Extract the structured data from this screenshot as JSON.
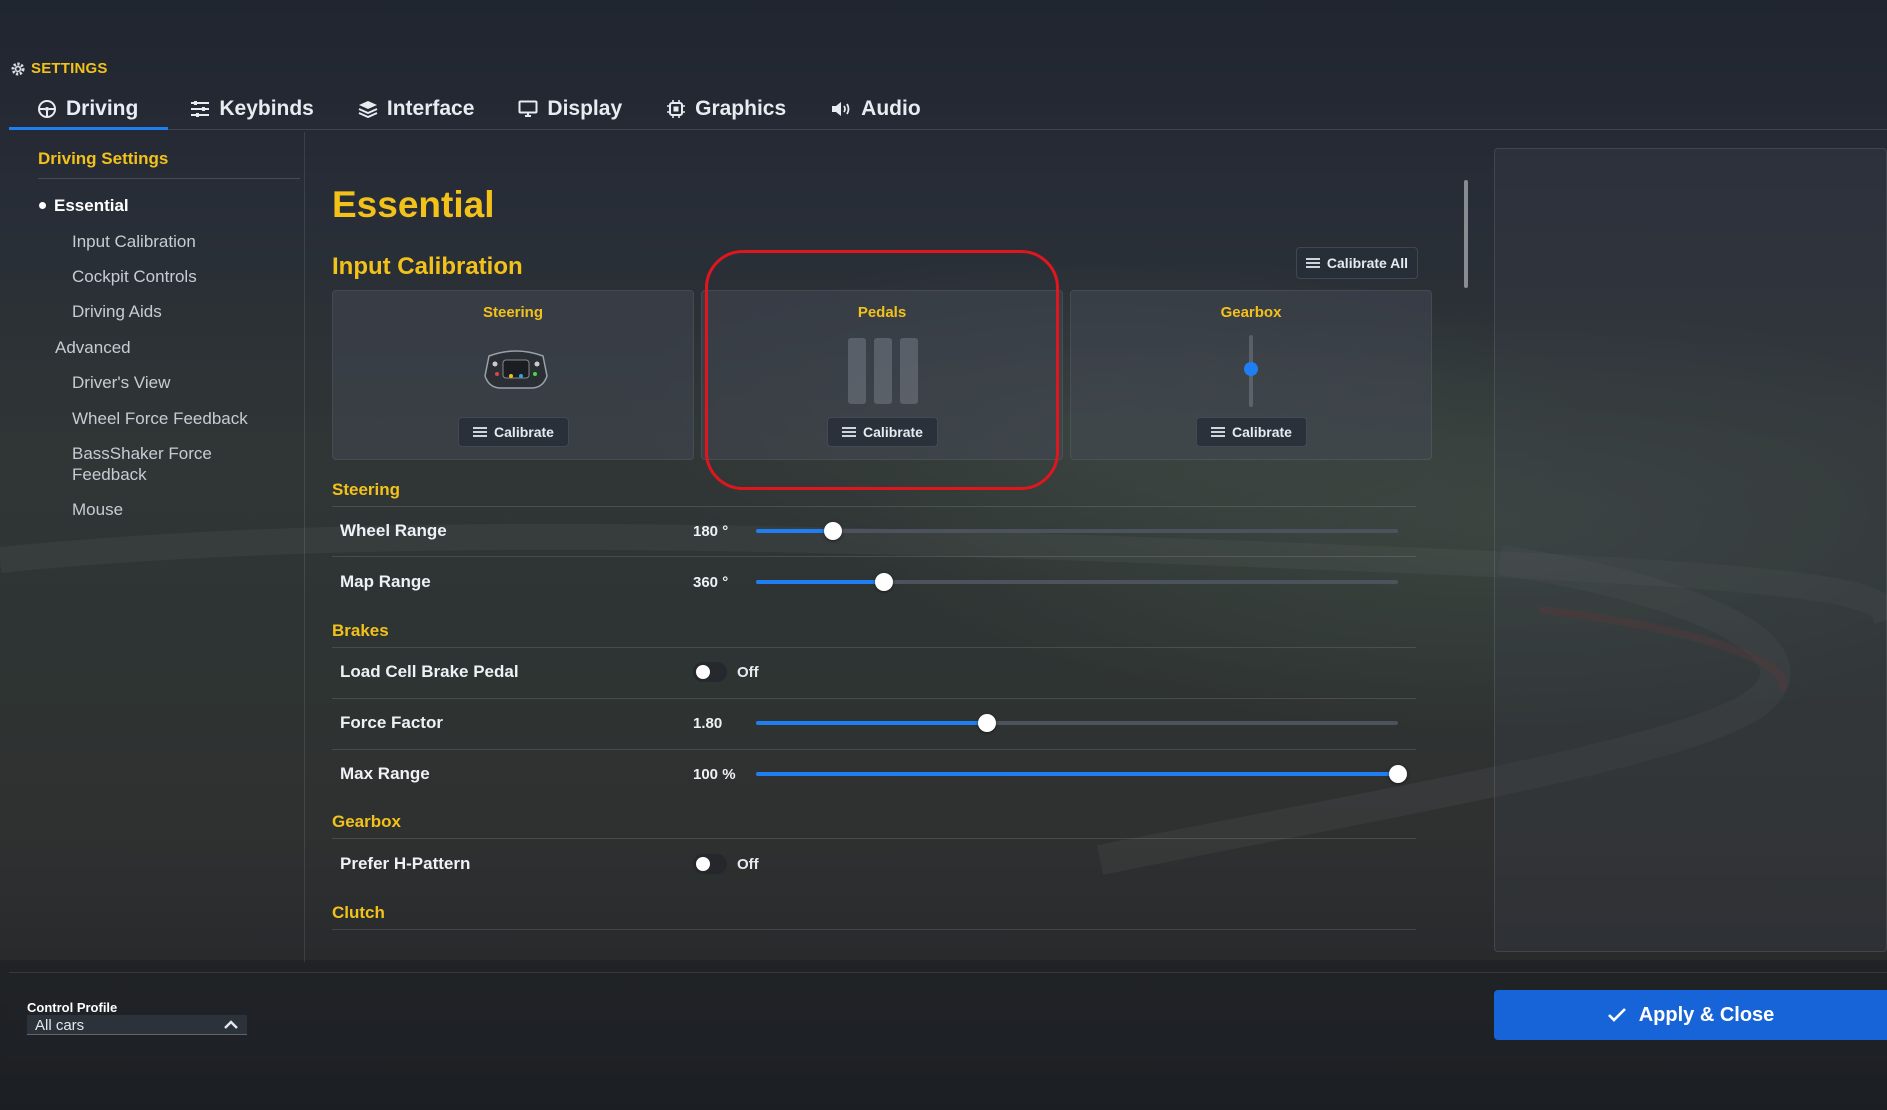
{
  "header": {
    "title": "SETTINGS"
  },
  "tabs": [
    {
      "label": "Driving",
      "icon": "steering-wheel-icon",
      "active": true
    },
    {
      "label": "Keybinds",
      "icon": "sliders-icon"
    },
    {
      "label": "Interface",
      "icon": "layers-icon"
    },
    {
      "label": "Display",
      "icon": "monitor-icon"
    },
    {
      "label": "Graphics",
      "icon": "chip-icon"
    },
    {
      "label": "Audio",
      "icon": "speaker-icon"
    }
  ],
  "sidebar": {
    "heading": "Driving Settings",
    "items": [
      {
        "label": "Essential",
        "active": true
      },
      {
        "label": "Input Calibration"
      },
      {
        "label": "Cockpit Controls"
      },
      {
        "label": "Driving Aids"
      },
      {
        "label": "Advanced"
      },
      {
        "label": "Driver's View"
      },
      {
        "label": "Wheel Force Feedback"
      },
      {
        "label": "BassShaker Force Feedback"
      },
      {
        "label": "Mouse"
      }
    ]
  },
  "main": {
    "title": "Essential",
    "input_calibration": {
      "title": "Input Calibration",
      "calibrate_all_label": "Calibrate All",
      "cards": [
        {
          "title": "Steering",
          "button": "Calibrate",
          "icon": "steering-wheel-icon"
        },
        {
          "title": "Pedals",
          "button": "Calibrate",
          "icon": "pedals-icon"
        },
        {
          "title": "Gearbox",
          "button": "Calibrate",
          "icon": "gearbox-slider-icon"
        }
      ]
    },
    "sections": {
      "steering": "Steering",
      "brakes": "Brakes",
      "gearbox": "Gearbox",
      "clutch": "Clutch"
    },
    "settings": {
      "wheel_range": {
        "label": "Wheel Range",
        "value": "180 °",
        "fraction": 0.12
      },
      "map_range": {
        "label": "Map Range",
        "value": "360 °",
        "fraction": 0.2
      },
      "load_cell": {
        "label": "Load Cell Brake Pedal",
        "state": "Off"
      },
      "force_factor": {
        "label": "Force Factor",
        "value": "1.80",
        "fraction": 0.36
      },
      "max_range": {
        "label": "Max Range",
        "value": "100 %",
        "fraction": 1.0
      },
      "prefer_h_pattern": {
        "label": "Prefer H-Pattern",
        "state": "Off"
      }
    }
  },
  "footer": {
    "profile_label": "Control Profile",
    "profile_value": "All cars",
    "apply_label": "Apply & Close"
  },
  "colors": {
    "accent": "#f3c21a",
    "primary": "#1f7ff2",
    "highlight": "#e0161e"
  }
}
